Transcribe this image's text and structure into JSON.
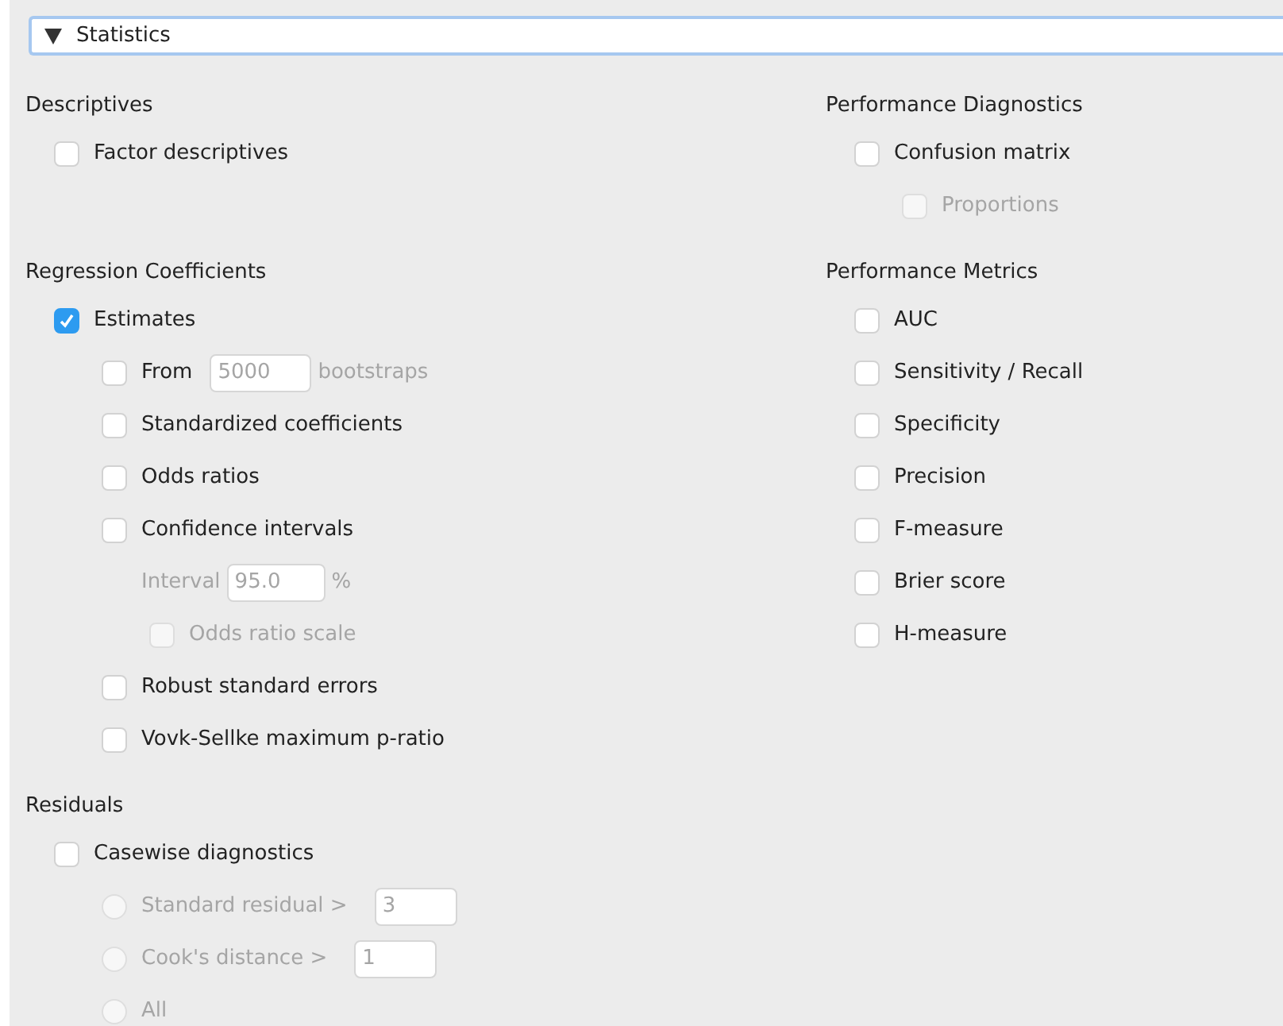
{
  "section": {
    "title": "Statistics",
    "expanded": true
  },
  "rows": [
    [
      {
        "title": "Descriptives",
        "items": [
          {
            "kind": "checkbox",
            "label": "Factor descriptives",
            "checked": false,
            "disabled": false
          }
        ]
      },
      {
        "title": "Performance Diagnostics",
        "items": [
          {
            "kind": "checkbox",
            "label": "Confusion matrix",
            "checked": false,
            "disabled": false,
            "children": [
              {
                "kind": "checkbox",
                "label": "Proportions",
                "checked": false,
                "disabled": true
              }
            ]
          }
        ]
      }
    ],
    [
      {
        "title": "Regression Coefficients",
        "items": [
          {
            "kind": "checkbox",
            "label": "Estimates",
            "checked": true,
            "disabled": false,
            "children": [
              {
                "kind": "checkbox_field",
                "label": "From",
                "checked": false,
                "disabled": false,
                "value": "5000",
                "suffix": "bootstraps",
                "field_disabled": true
              },
              {
                "kind": "checkbox",
                "label": "Standardized coefficients",
                "checked": false,
                "disabled": false
              },
              {
                "kind": "checkbox",
                "label": "Odds ratios",
                "checked": false,
                "disabled": false
              },
              {
                "kind": "checkbox",
                "label": "Confidence intervals",
                "checked": false,
                "disabled": false,
                "children": [
                  {
                    "kind": "field",
                    "label": "Interval",
                    "value": "95.0",
                    "suffix": "%",
                    "disabled": true
                  },
                  {
                    "kind": "checkbox",
                    "label": "Odds ratio scale",
                    "checked": false,
                    "disabled": true
                  }
                ]
              },
              {
                "kind": "checkbox",
                "label": "Robust standard errors",
                "checked": false,
                "disabled": false
              },
              {
                "kind": "checkbox",
                "label": "Vovk-Sellke maximum p-ratio",
                "checked": false,
                "disabled": false
              }
            ]
          }
        ]
      },
      {
        "title": "Performance Metrics",
        "items": [
          {
            "kind": "checkbox",
            "label": "AUC",
            "checked": false,
            "disabled": false
          },
          {
            "kind": "checkbox",
            "label": "Sensitivity / Recall",
            "checked": false,
            "disabled": false
          },
          {
            "kind": "checkbox",
            "label": "Specificity",
            "checked": false,
            "disabled": false
          },
          {
            "kind": "checkbox",
            "label": "Precision",
            "checked": false,
            "disabled": false
          },
          {
            "kind": "checkbox",
            "label": "F-measure",
            "checked": false,
            "disabled": false
          },
          {
            "kind": "checkbox",
            "label": "Brier score",
            "checked": false,
            "disabled": false
          },
          {
            "kind": "checkbox",
            "label": "H-measure",
            "checked": false,
            "disabled": false
          }
        ]
      }
    ],
    [
      {
        "title": "Residuals",
        "items": [
          {
            "kind": "checkbox",
            "label": "Casewise diagnostics",
            "checked": false,
            "disabled": false,
            "children": [
              {
                "kind": "radio_field",
                "label": "Standard residual >",
                "selected": false,
                "disabled": true,
                "value": "3"
              },
              {
                "kind": "radio_field",
                "label": "Cook's distance >",
                "selected": false,
                "disabled": true,
                "value": "1"
              },
              {
                "kind": "radio",
                "label": "All",
                "selected": false,
                "disabled": true
              }
            ]
          }
        ]
      }
    ]
  ]
}
